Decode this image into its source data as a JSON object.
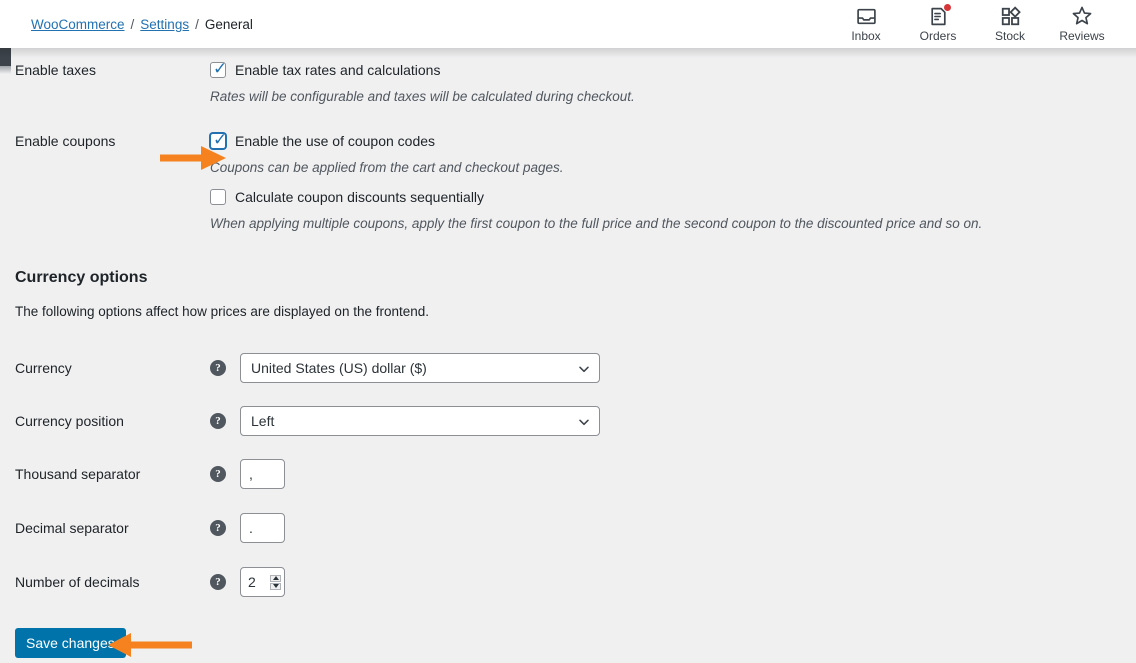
{
  "header": {
    "breadcrumb": {
      "root": "WooCommerce",
      "section": "Settings",
      "current": "General",
      "separator": "/"
    },
    "nav_items": [
      {
        "label": "Inbox",
        "icon": "inbox-icon",
        "badge": false
      },
      {
        "label": "Orders",
        "icon": "orders-icon",
        "badge": true
      },
      {
        "label": "Stock",
        "icon": "stock-icon",
        "badge": false
      },
      {
        "label": "Reviews",
        "icon": "reviews-star-icon",
        "badge": false
      }
    ]
  },
  "settings": {
    "enable_taxes": {
      "label": "Enable taxes",
      "checkbox_label": "Enable tax rates and calculations",
      "checked": true,
      "focused": false,
      "description": "Rates will be configurable and taxes will be calculated during checkout."
    },
    "enable_coupons": {
      "label": "Enable coupons",
      "checkbox_label": "Enable the use of coupon codes",
      "checked": true,
      "focused": true,
      "description": "Coupons can be applied from the cart and checkout pages.",
      "secondary_checkbox_label": "Calculate coupon discounts sequentially",
      "secondary_checked": false,
      "secondary_description": "When applying multiple coupons, apply the first coupon to the full price and the second coupon to the discounted price and so on."
    }
  },
  "currency_options": {
    "title": "Currency options",
    "description": "The following options affect how prices are displayed on the frontend.",
    "fields": [
      {
        "label": "Currency",
        "type": "select",
        "value": "United States (US) dollar ($)",
        "help": "?"
      },
      {
        "label": "Currency position",
        "type": "select",
        "value": "Left",
        "help": "?"
      },
      {
        "label": "Thousand separator",
        "type": "text",
        "value": ",",
        "help": "?"
      },
      {
        "label": "Decimal separator",
        "type": "text",
        "value": ".",
        "help": "?"
      },
      {
        "label": "Number of decimals",
        "type": "number",
        "value": "2",
        "help": "?"
      }
    ]
  },
  "actions": {
    "save_label": "Save changes"
  },
  "annotations": {
    "arrow_color": "#f5821f",
    "arrows": [
      {
        "target": "enable-coupons-checkbox",
        "direction": "right"
      },
      {
        "target": "save-changes-button",
        "direction": "left"
      }
    ]
  },
  "colors": {
    "accent_blue": "#2271b1",
    "button_blue": "#0073aa",
    "background": "#f0f0f1",
    "badge_red": "#d63638",
    "text": "#1d2327"
  }
}
